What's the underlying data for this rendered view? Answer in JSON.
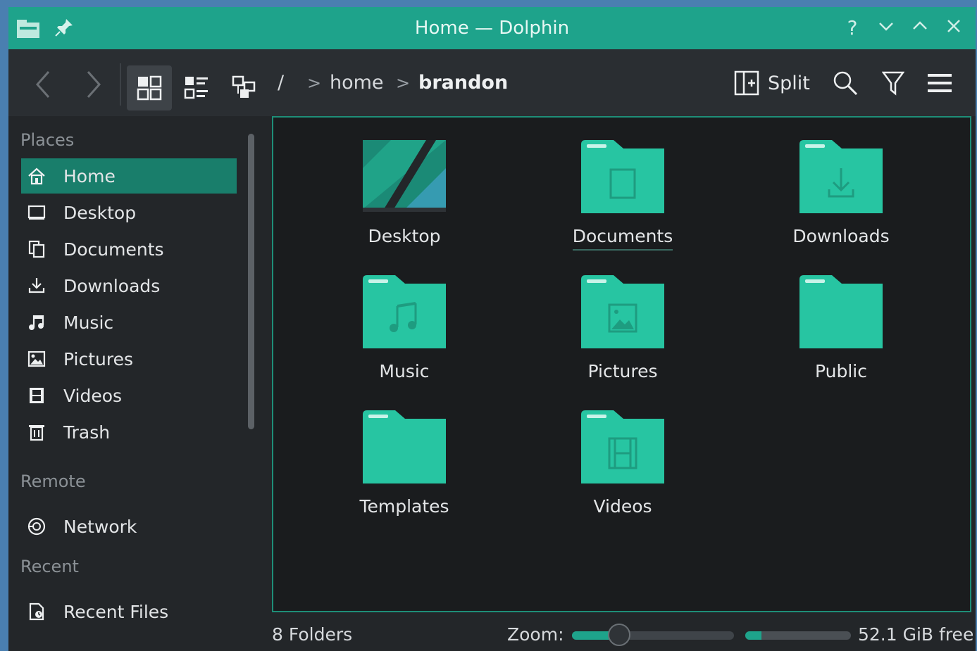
{
  "window": {
    "title": "Home — Dolphin",
    "title_buttons": [
      "?",
      "⌄",
      "⌃",
      "✕"
    ]
  },
  "colors": {
    "accent": "#1ea38b",
    "selection": "#197e6b",
    "folder": "#27c5a2",
    "background": "#232629",
    "view_background": "#1a1c1e"
  },
  "toolbar": {
    "back_icon": "back-icon",
    "forward_icon": "forward-icon",
    "icons_view_icon": "icons-view-icon",
    "compact_view_icon": "compact-view-icon",
    "details_view_icon": "details-view-icon",
    "split_label": "Split",
    "search_icon": "search-icon",
    "filter_icon": "filter-icon",
    "menu_icon": "hamburger-menu-icon"
  },
  "breadcrumb": {
    "root": "/",
    "items": [
      "home",
      "brandon"
    ],
    "separator": ">"
  },
  "sidebar": {
    "sections": [
      {
        "label": "Places"
      },
      {
        "label": "Remote"
      },
      {
        "label": "Recent"
      }
    ],
    "places": [
      {
        "label": "Home",
        "icon": "home-icon",
        "active": true
      },
      {
        "label": "Desktop",
        "icon": "desktop-icon"
      },
      {
        "label": "Documents",
        "icon": "documents-icon"
      },
      {
        "label": "Downloads",
        "icon": "downloads-icon"
      },
      {
        "label": "Music",
        "icon": "music-icon"
      },
      {
        "label": "Pictures",
        "icon": "pictures-icon"
      },
      {
        "label": "Videos",
        "icon": "videos-icon"
      },
      {
        "label": "Trash",
        "icon": "trash-icon"
      }
    ],
    "remote": [
      {
        "label": "Network",
        "icon": "network-icon"
      }
    ],
    "recent": [
      {
        "label": "Recent Files",
        "icon": "recent-files-icon"
      }
    ]
  },
  "files": [
    {
      "name": "Desktop",
      "icon": "desktop-folder-icon"
    },
    {
      "name": "Documents",
      "icon": "documents-folder-icon",
      "hovered": true
    },
    {
      "name": "Downloads",
      "icon": "downloads-folder-icon"
    },
    {
      "name": "Music",
      "icon": "music-folder-icon"
    },
    {
      "name": "Pictures",
      "icon": "pictures-folder-icon"
    },
    {
      "name": "Public",
      "icon": "public-folder-icon"
    },
    {
      "name": "Templates",
      "icon": "templates-folder-icon"
    },
    {
      "name": "Videos",
      "icon": "videos-folder-icon"
    }
  ],
  "status": {
    "summary": "8 Folders",
    "zoom_label": "Zoom:",
    "zoom_level": 0.29,
    "free_space": "52.1 GiB free",
    "space_used_fraction": 0.15
  }
}
